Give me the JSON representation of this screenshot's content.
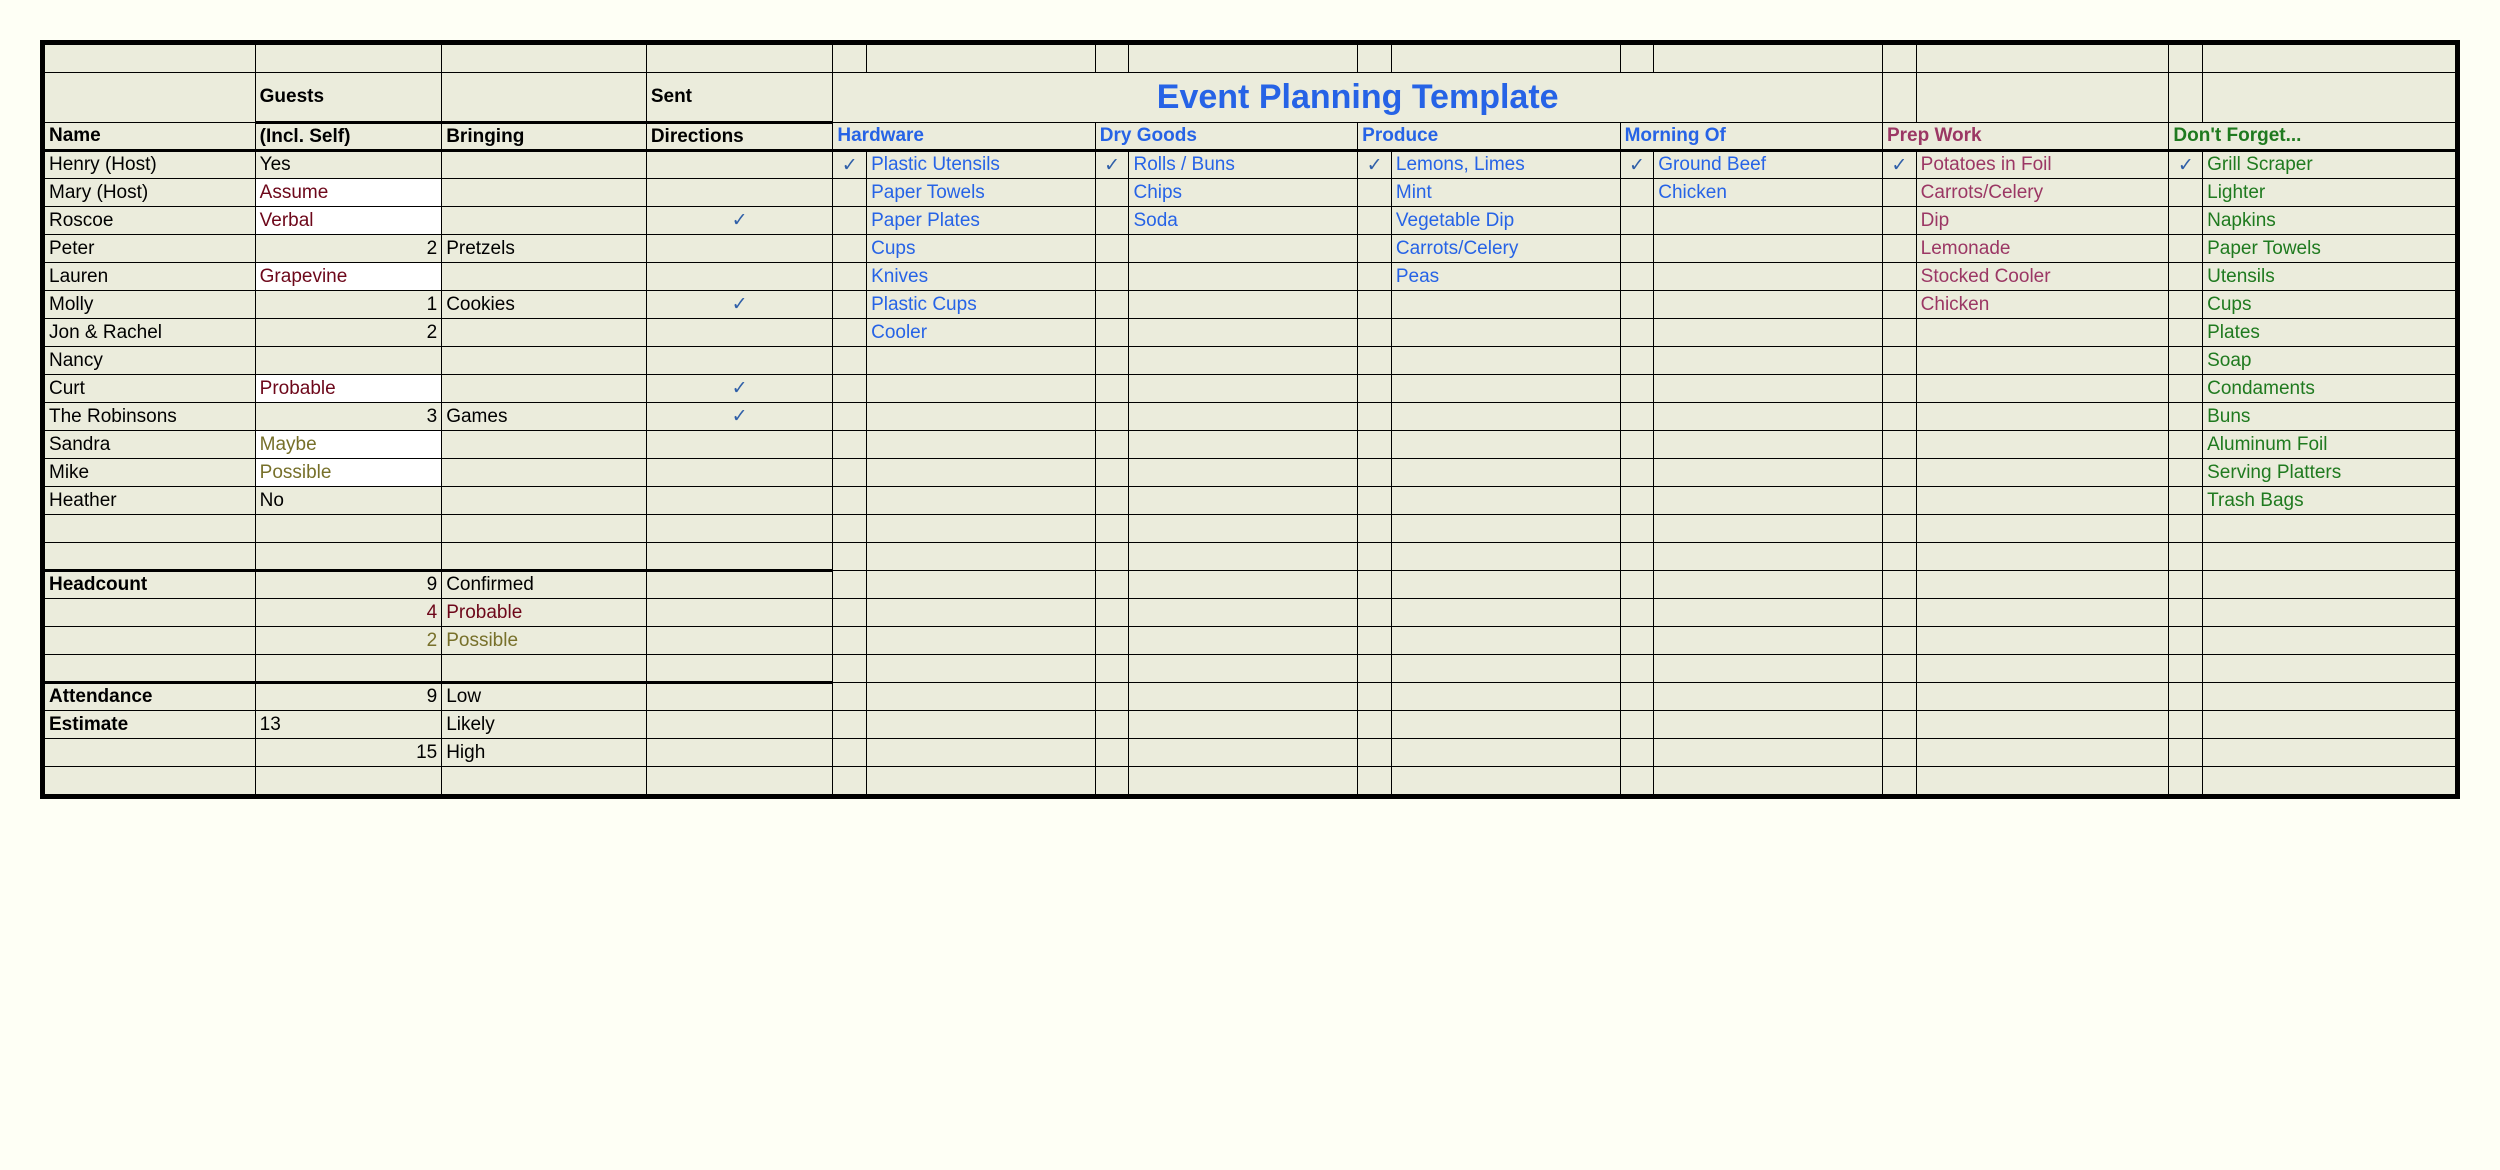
{
  "title": "Event Planning Template",
  "hdr": {
    "guests": "Guests",
    "sent": "Sent",
    "name": "Name",
    "incl": "(Incl. Self)",
    "bring": "Bringing",
    "dir": "Directions",
    "hw": "Hardware",
    "dry": "Dry Goods",
    "prod": "Produce",
    "morn": "Morning Of",
    "prep": "Prep Work",
    "forget": "Don't Forget..."
  },
  "guests": [
    {
      "name": "Henry (Host)",
      "incl": "Yes",
      "bring": "",
      "dir": ""
    },
    {
      "name": "Mary (Host)",
      "incl": "Assume",
      "inclCls": "red white-bg",
      "bring": "",
      "dir": ""
    },
    {
      "name": "Roscoe",
      "incl": "Verbal",
      "inclCls": "red white-bg",
      "bring": "",
      "dir": "✓"
    },
    {
      "name": "Peter",
      "incl": "2",
      "inclRight": true,
      "bring": "Pretzels",
      "dir": ""
    },
    {
      "name": "Lauren",
      "incl": "Grapevine",
      "inclCls": "red white-bg",
      "bring": "",
      "dir": ""
    },
    {
      "name": "Molly",
      "incl": "1",
      "inclRight": true,
      "bring": "Cookies",
      "dir": "✓"
    },
    {
      "name": "Jon & Rachel",
      "incl": "2",
      "inclRight": true,
      "bring": "",
      "dir": ""
    },
    {
      "name": "Nancy",
      "incl": "",
      "bring": "",
      "dir": ""
    },
    {
      "name": "Curt",
      "incl": "Probable",
      "inclCls": "red white-bg",
      "bring": "",
      "dir": "✓"
    },
    {
      "name": "The Robinsons",
      "incl": "3",
      "inclRight": true,
      "bring": "Games",
      "dir": "✓"
    },
    {
      "name": "Sandra",
      "incl": "Maybe",
      "inclCls": "olive white-bg",
      "bring": "",
      "dir": ""
    },
    {
      "name": "Mike",
      "incl": "Possible",
      "inclCls": "olive white-bg",
      "bring": "",
      "dir": ""
    },
    {
      "name": "Heather",
      "incl": "No",
      "bring": "",
      "dir": ""
    }
  ],
  "hw": [
    {
      "c": "✓",
      "t": "Plastic Utensils"
    },
    {
      "c": "",
      "t": "Paper Towels"
    },
    {
      "c": "",
      "t": "Paper Plates"
    },
    {
      "c": "",
      "t": "Cups"
    },
    {
      "c": "",
      "t": "Knives"
    },
    {
      "c": "",
      "t": "Plastic Cups"
    },
    {
      "c": "",
      "t": "Cooler"
    }
  ],
  "dry": [
    {
      "c": "✓",
      "t": "Rolls / Buns"
    },
    {
      "c": "",
      "t": "Chips"
    },
    {
      "c": "",
      "t": "Soda"
    }
  ],
  "prod": [
    {
      "c": "✓",
      "t": "Lemons, Limes"
    },
    {
      "c": "",
      "t": "Mint"
    },
    {
      "c": "",
      "t": "Vegetable Dip"
    },
    {
      "c": "",
      "t": "Carrots/Celery"
    },
    {
      "c": "",
      "t": "Peas"
    }
  ],
  "morn": [
    {
      "c": "✓",
      "t": "Ground Beef"
    },
    {
      "c": "",
      "t": "Chicken"
    }
  ],
  "prep": [
    {
      "c": "✓",
      "t": "Potatoes in Foil"
    },
    {
      "c": "",
      "t": "Carrots/Celery"
    },
    {
      "c": "",
      "t": "Dip"
    },
    {
      "c": "",
      "t": "Lemonade"
    },
    {
      "c": "",
      "t": "Stocked Cooler"
    },
    {
      "c": "",
      "t": "Chicken"
    }
  ],
  "forget": [
    {
      "c": "✓",
      "t": "Grill Scraper"
    },
    {
      "c": "",
      "t": "Lighter"
    },
    {
      "c": "",
      "t": "Napkins"
    },
    {
      "c": "",
      "t": "Paper Towels"
    },
    {
      "c": "",
      "t": "Utensils"
    },
    {
      "c": "",
      "t": "Cups"
    },
    {
      "c": "",
      "t": "Plates"
    },
    {
      "c": "",
      "t": "Soap"
    },
    {
      "c": "",
      "t": "Condaments"
    },
    {
      "c": "",
      "t": "Buns"
    },
    {
      "c": "",
      "t": "Aluminum Foil"
    },
    {
      "c": "",
      "t": "Serving Platters"
    },
    {
      "c": "",
      "t": "Trash Bags"
    }
  ],
  "summary": {
    "headcount": "Headcount",
    "confirmed_n": "9",
    "confirmed": "Confirmed",
    "probable_n": "4",
    "probable": "Probable",
    "possible_n": "2",
    "possible": "Possible",
    "attendance": "Attendance",
    "estimate": "Estimate",
    "low_n": "9",
    "low": "Low",
    "likely_n": "13",
    "likely": "Likely",
    "high_n": "15",
    "high": "High"
  }
}
